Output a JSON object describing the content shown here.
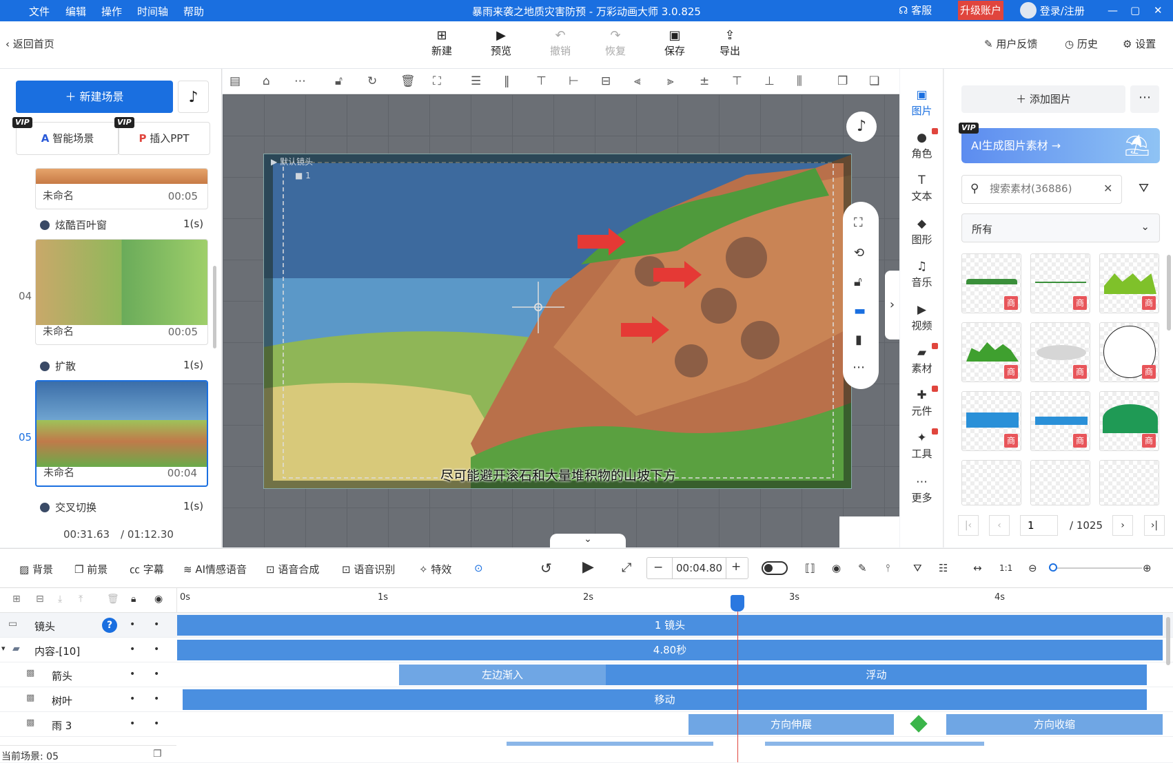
{
  "window": {
    "title": "暴雨来袭之地质灾害防预 - 万彩动画大师 3.0.825",
    "menus": [
      "文件",
      "编辑",
      "操作",
      "时间轴",
      "帮助"
    ],
    "service": "客服",
    "upgrade": "升级账户",
    "login": "登录/注册"
  },
  "toolbar": {
    "back": "返回首页",
    "tools": [
      "新建",
      "预览",
      "撤销",
      "恢复",
      "保存",
      "导出"
    ],
    "feedback": "用户反馈",
    "history": "历史",
    "settings": "设置"
  },
  "left": {
    "new_scene": "新建场景",
    "smart_scene": "智能场景",
    "insert_ppt": "插入PPT",
    "vip": "VIP",
    "scenes": [
      {
        "num": "",
        "name": "未命名",
        "time": "00:05",
        "transition": "炫酷百叶窗",
        "dur": "1(s)"
      },
      {
        "num": "04",
        "name": "未命名",
        "time": "00:05",
        "transition": "扩散",
        "dur": "1(s)"
      },
      {
        "num": "05",
        "name": "未命名",
        "time": "00:04",
        "transition": "交叉切换",
        "dur": "1(s)"
      }
    ],
    "time_current": "00:31.63",
    "time_total": "/ 01:12.30"
  },
  "canvas": {
    "camera_label": "默认镜头",
    "camera_num": "1",
    "subtitle": "尽可能避开滚石和大量堆积物的山坡下方"
  },
  "sidetabs": [
    "图片",
    "角色",
    "文本",
    "图形",
    "音乐",
    "视频",
    "素材",
    "元件",
    "工具",
    "更多"
  ],
  "assets": {
    "add_image": "添加图片",
    "ai_banner": "AI生成图片素材 →",
    "search_placeholder": "搜索素材(36886)",
    "filter": "所有",
    "shang": "商",
    "page": "1",
    "page_total": "/ 1025"
  },
  "timeline_ctrl": {
    "bg": "背景",
    "fg": "前景",
    "subtitle": "字幕",
    "ai_voice": "AI情感语音",
    "tts": "语音合成",
    "asr": "语音识别",
    "effects": "特效",
    "time": "00:04.80"
  },
  "timeline": {
    "ruler": [
      "0s",
      "1s",
      "2s",
      "3s",
      "4s"
    ],
    "tracks": [
      {
        "name": "镜头",
        "bars": [
          "1 镜头"
        ]
      },
      {
        "name": "内容-[10]",
        "bars": [
          "4.80秒"
        ]
      },
      {
        "name": "箭头",
        "bars": [
          "左边渐入",
          "浮动"
        ]
      },
      {
        "name": "树叶",
        "bars": [
          "移动"
        ]
      },
      {
        "name": "雨 3",
        "bars": [
          "方向伸展",
          "方向收缩"
        ]
      }
    ],
    "current_scene": "当前场景: 05"
  }
}
